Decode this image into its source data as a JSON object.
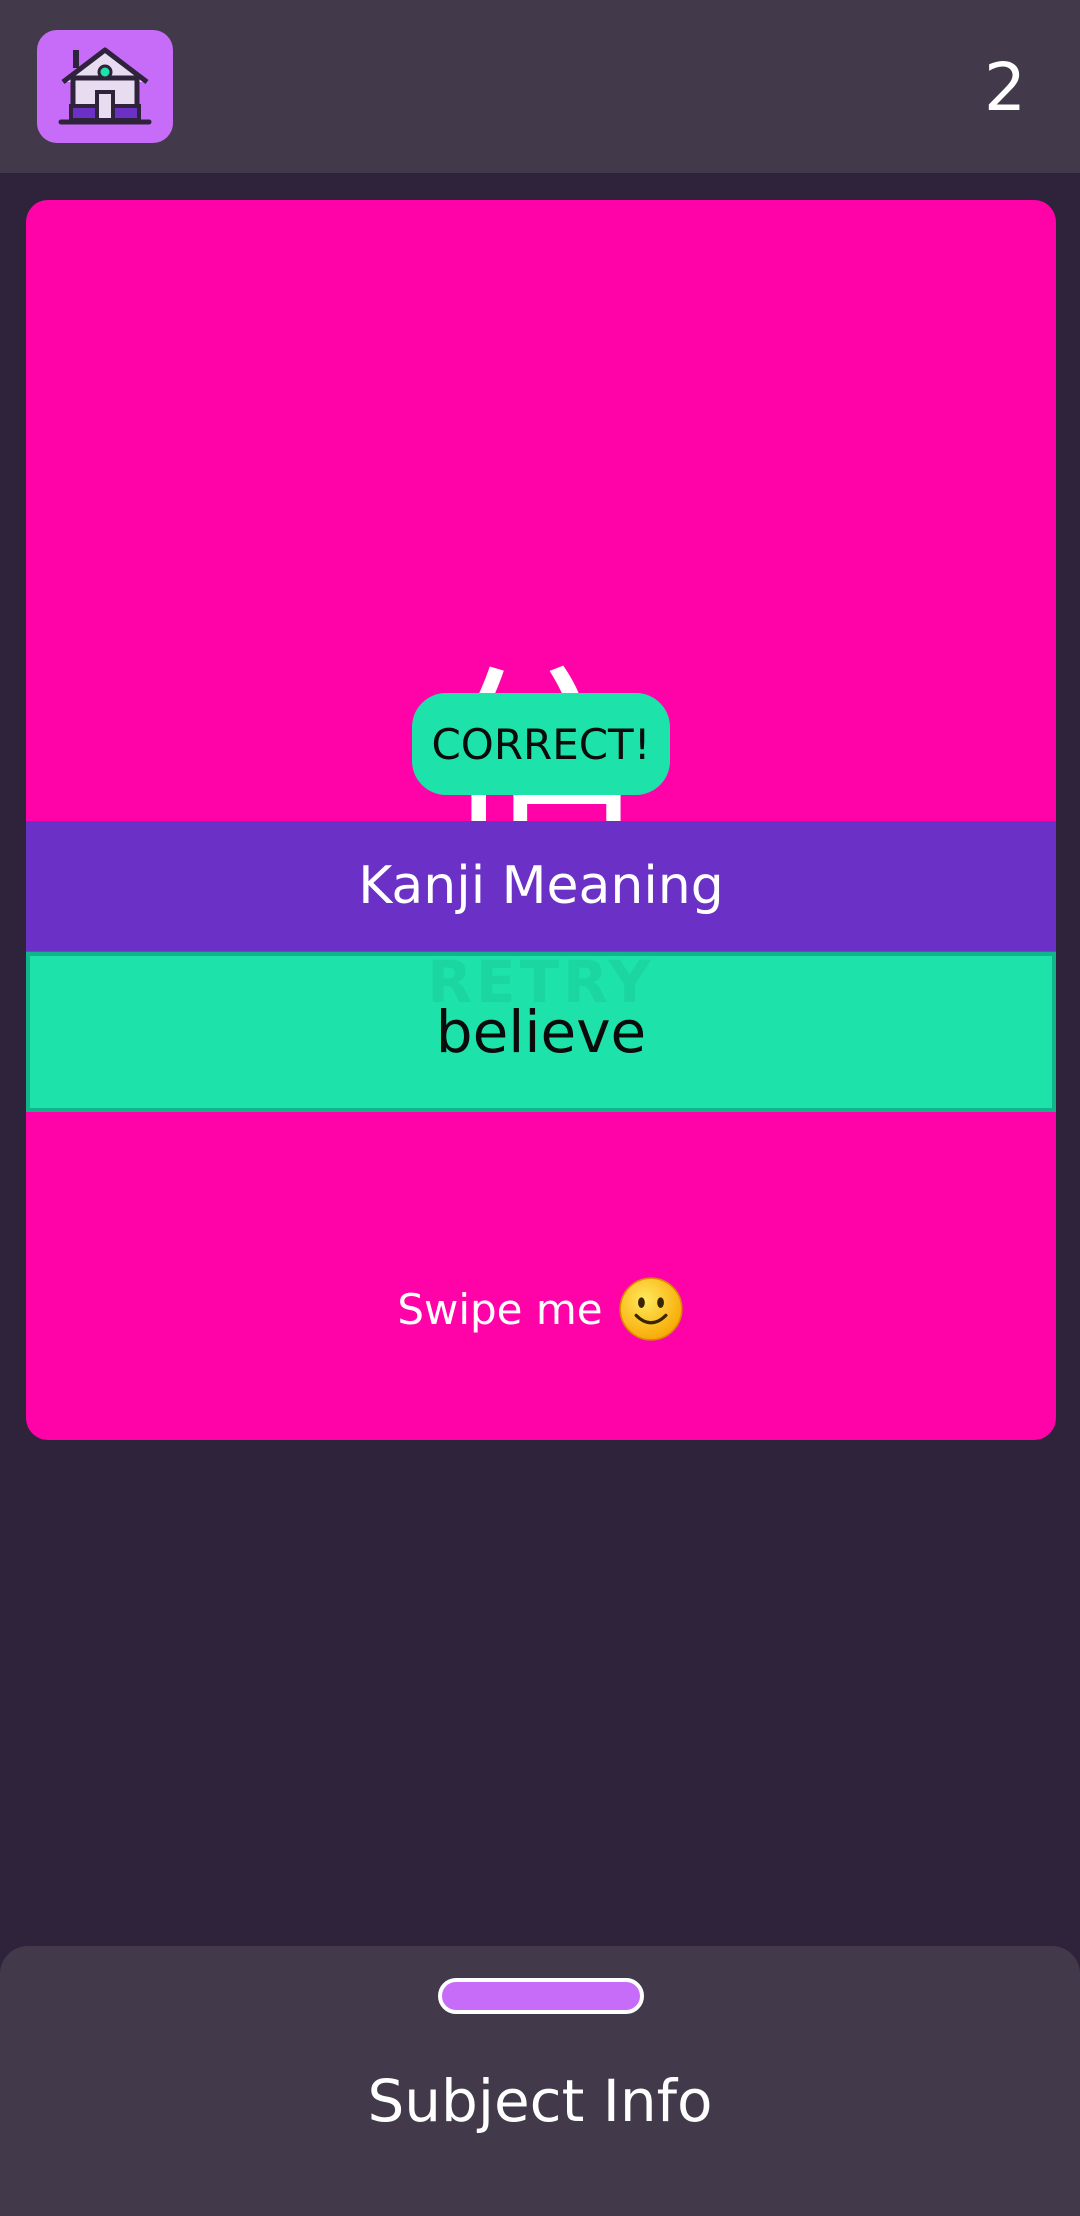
{
  "header": {
    "home_icon": "house-icon",
    "counter": "2"
  },
  "card": {
    "kanji": "信",
    "result_label": "CORRECT!",
    "meaning_header": "Kanji Meaning",
    "answer": "believe",
    "ghost_label": "RETRY",
    "swipe_hint": "Swipe me",
    "swipe_icon": "smiley-icon"
  },
  "bottom_sheet": {
    "title": "Subject Info"
  },
  "colors": {
    "background": "#2f233c",
    "topbar": "#423a4a",
    "card": "#ff02a8",
    "accent_purple": "#6b31c6",
    "correct_green": "#1de2aa",
    "home_button": "#c76cf8"
  }
}
